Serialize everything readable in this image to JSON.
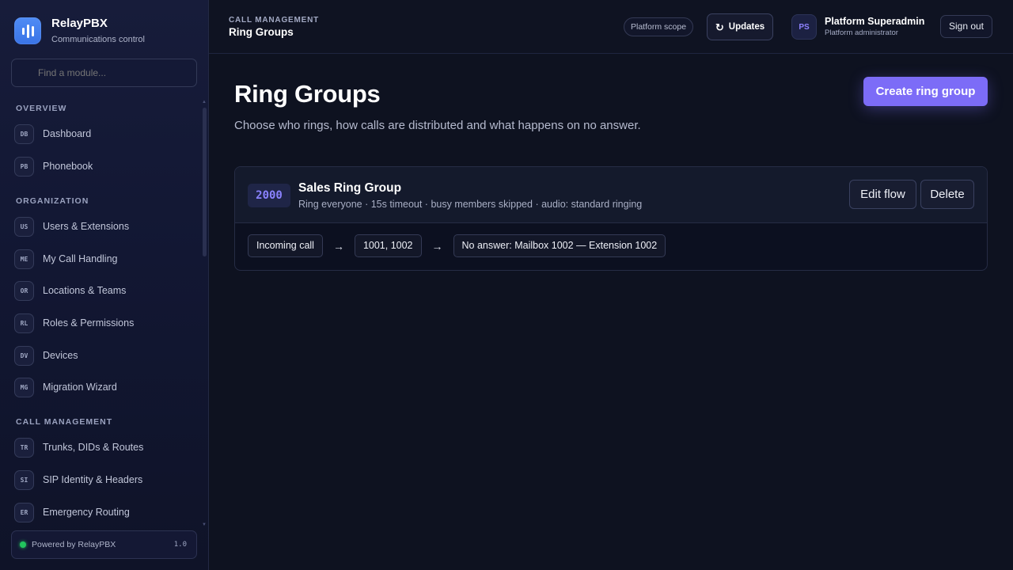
{
  "brand": {
    "name": "RelayPBX",
    "subtitle": "Communications control"
  },
  "search": {
    "placeholder": "Find a module..."
  },
  "sidebar": {
    "sections": [
      {
        "label": "OVERVIEW"
      },
      {
        "label": "ORGANIZATION"
      },
      {
        "label": "CALL MANAGEMENT"
      }
    ],
    "items": [
      {
        "badge": "DB",
        "label": "Dashboard"
      },
      {
        "badge": "PB",
        "label": "Phonebook"
      },
      {
        "badge": "US",
        "label": "Users & Extensions"
      },
      {
        "badge": "ME",
        "label": "My Call Handling"
      },
      {
        "badge": "OR",
        "label": "Locations & Teams"
      },
      {
        "badge": "RL",
        "label": "Roles & Permissions"
      },
      {
        "badge": "DV",
        "label": "Devices"
      },
      {
        "badge": "MG",
        "label": "Migration Wizard"
      },
      {
        "badge": "TR",
        "label": "Trunks, DIDs & Routes"
      },
      {
        "badge": "SI",
        "label": "SIP Identity & Headers"
      },
      {
        "badge": "ER",
        "label": "Emergency Routing"
      }
    ],
    "footer": {
      "text": "Powered by RelayPBX",
      "version": "1.0",
      "status_color": "#22c55e"
    }
  },
  "header": {
    "section": "CALL MANAGEMENT",
    "title": "Ring Groups",
    "scope": "Platform scope",
    "updates_label": "Updates",
    "updates_icon": "refresh-icon",
    "user": {
      "initials": "PS",
      "name": "Platform Superadmin",
      "role": "Platform administrator"
    },
    "signout_label": "Sign out"
  },
  "main": {
    "title": "Ring Groups",
    "subtitle": "Choose who rings, how calls are distributed and what happens on no answer.",
    "create_label": "Create ring group",
    "accent_color": "#7c6cf7",
    "ring_groups": [
      {
        "number": "2000",
        "name": "Sales Ring Group",
        "meta": "Ring everyone · 15s timeout · busy members skipped · audio: standard ringing",
        "edit_label": "Edit flow",
        "delete_label": "Delete",
        "flow": {
          "start": "Incoming call",
          "members": "1001, 1002",
          "no_answer": "No answer: Mailbox 1002 — Extension 1002",
          "arrow": "→"
        }
      }
    ]
  }
}
